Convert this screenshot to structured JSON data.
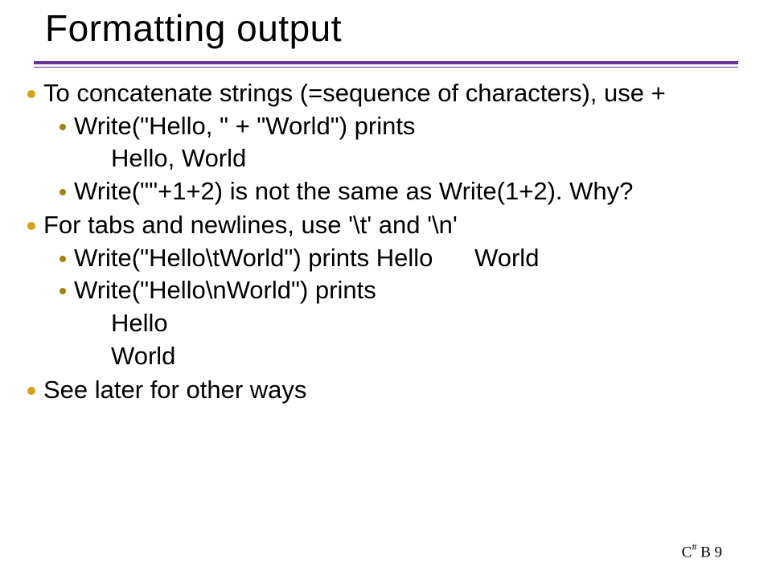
{
  "title": "Formatting output",
  "bullets": {
    "b1": "To concatenate strings (=sequence of characters), use +",
    "b1a": "Write(\"Hello, \" + \"World\") prints",
    "b1a_out": "Hello, World",
    "b1b": "Write(\"\"+1+2) is not the same as Write(1+2). Why?",
    "b2": "For tabs and newlines, use '\\t' and '\\n'",
    "b2a_pre": "Write(\"Hello\\tWorld\") prints Hello",
    "b2a_post": "World",
    "b2b": "Write(\"Hello\\nWorld\") prints",
    "b2b_out1": "Hello",
    "b2b_out2": "World",
    "b3": "See later for other ways"
  },
  "footer": {
    "left": "C",
    "hash": "#",
    "right": " B 9"
  }
}
